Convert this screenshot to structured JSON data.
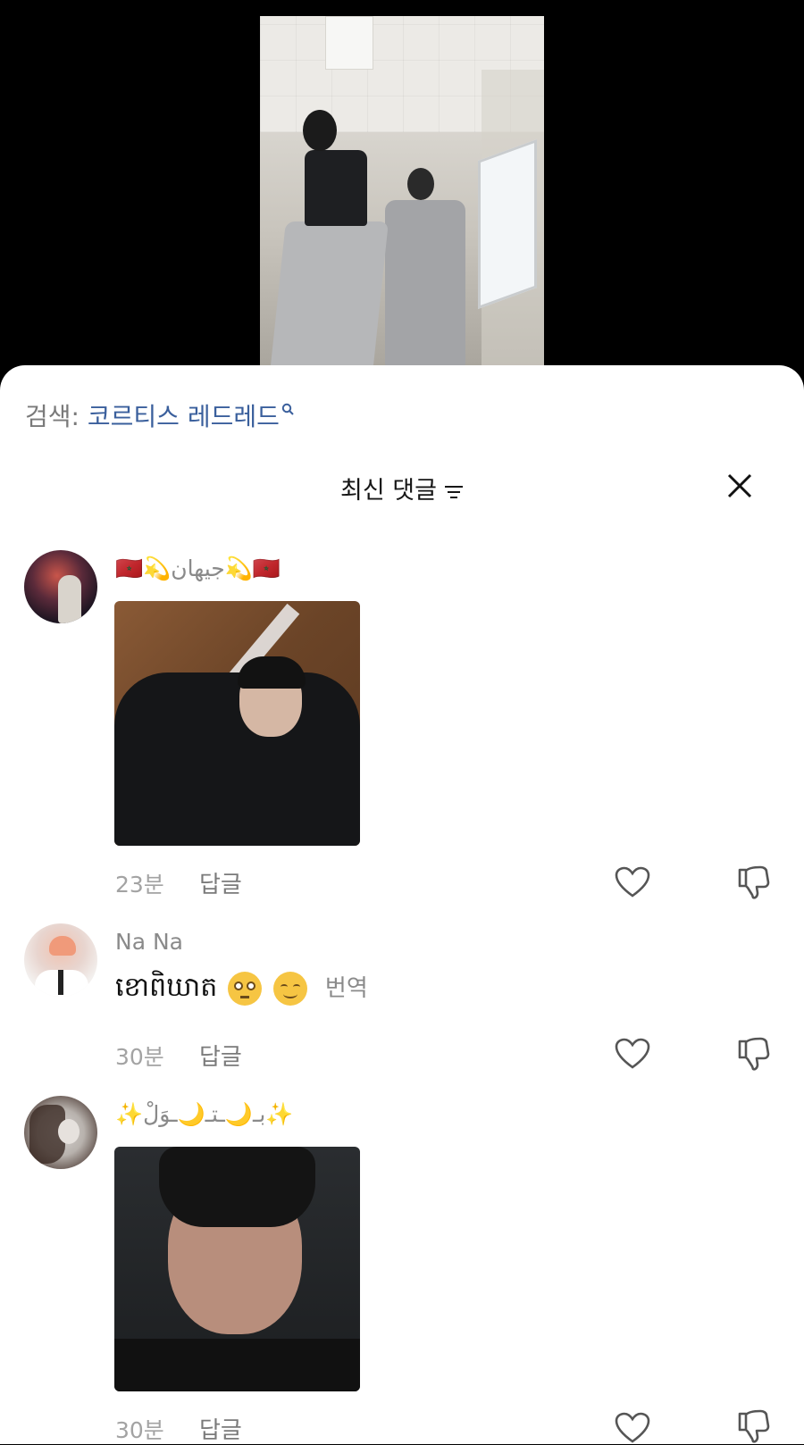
{
  "search": {
    "prefix": "검색:",
    "term": "코르티스 레드레드"
  },
  "sheet": {
    "title": "최신 댓글"
  },
  "comments": [
    {
      "username": "🇲🇦💫جيهان💫🇲🇦",
      "text": "",
      "time": "23분",
      "reply_label": "답글",
      "has_image": true
    },
    {
      "username": "Na Na",
      "text": "ខោពិឃាត",
      "translate_label": "번역",
      "time": "30분",
      "reply_label": "답글",
      "has_image": false
    },
    {
      "username": "✨بـ🌙ـتـ🌙ـوَلْ✨",
      "text": "",
      "time": "30분",
      "reply_label": "답글",
      "has_image": true
    }
  ],
  "colors": {
    "search_term": "#3a5f9c",
    "muted_text": "#8a8a8a",
    "sheet_bg": "#ffffff",
    "background": "#000000"
  },
  "icons": [
    "search-icon",
    "filter-icon",
    "close-icon",
    "heart-icon",
    "dislike-icon"
  ]
}
